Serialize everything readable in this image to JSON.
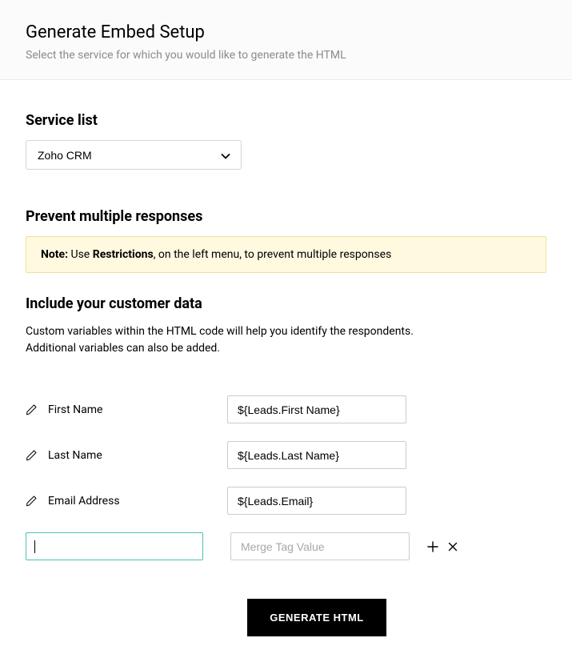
{
  "header": {
    "title": "Generate Embed Setup",
    "subtitle": "Select the service for which you would like to generate the HTML"
  },
  "service_list": {
    "heading": "Service list",
    "selected": "Zoho CRM"
  },
  "prevent_multiple": {
    "heading": "Prevent multiple responses",
    "note_label": "Note:",
    "note_text_1": " Use ",
    "note_bold": "Restrictions",
    "note_text_2": ", on the left menu, to prevent multiple responses"
  },
  "customer_data": {
    "heading": "Include your customer data",
    "description": "Custom variables within the HTML code will help you identify the respondents. Additional variables can also be added."
  },
  "variables": [
    {
      "label": "First Name",
      "value": "${Leads.First Name}"
    },
    {
      "label": "Last Name",
      "value": "${Leads.Last Name}"
    },
    {
      "label": "Email Address",
      "value": "${Leads.Email}"
    }
  ],
  "new_variable": {
    "name_value": "",
    "merge_placeholder": "Merge Tag Value"
  },
  "generate_button": "GENERATE HTML"
}
